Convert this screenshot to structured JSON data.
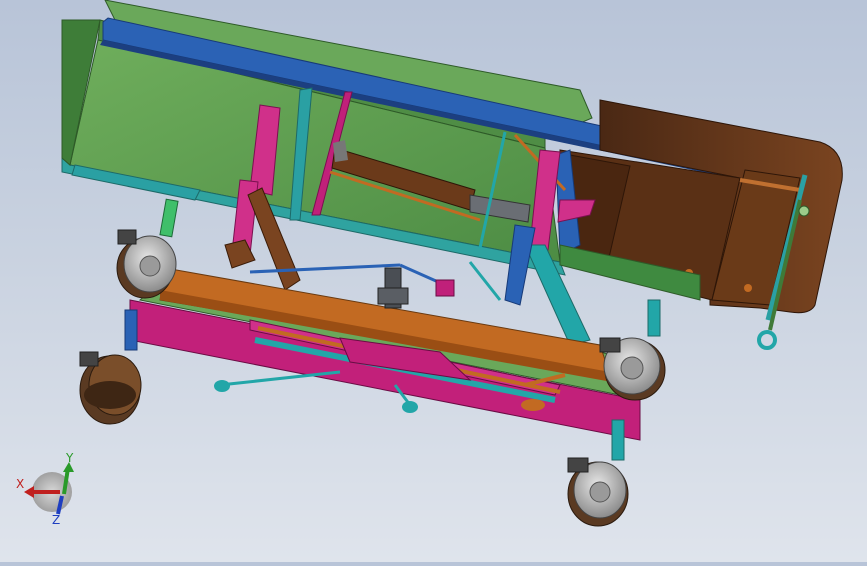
{
  "viewport": {
    "background_top": "#b8c4d8",
    "background_bottom": "#dfe4ec"
  },
  "model": {
    "parts": [
      "mattress-platform",
      "head-rail",
      "foot-board",
      "lift-frame",
      "actuator",
      "caster-wheel-front-left",
      "caster-wheel-front-right",
      "caster-wheel-rear-left",
      "caster-wheel-rear-right",
      "support-strut",
      "gas-spring"
    ],
    "colors": {
      "platform": "#5a9a4e",
      "platform_dark": "#3f7a38",
      "rail": "#2a5fb0",
      "rail_dark": "#1c3f80",
      "footboard": "#6b3a1a",
      "frame_orange": "#c26a22",
      "frame_magenta": "#c0207a",
      "cyan": "#22a6a8",
      "caster_body": "#a9a9a9",
      "caster_wheel": "#5a3a22",
      "actuator_gray": "#555a60"
    }
  },
  "triad": {
    "x_label": "X",
    "y_label": "Y",
    "z_label": "Z",
    "x_color": "#c0201e",
    "y_color": "#2a9a2a",
    "z_color": "#1e3ec0"
  }
}
